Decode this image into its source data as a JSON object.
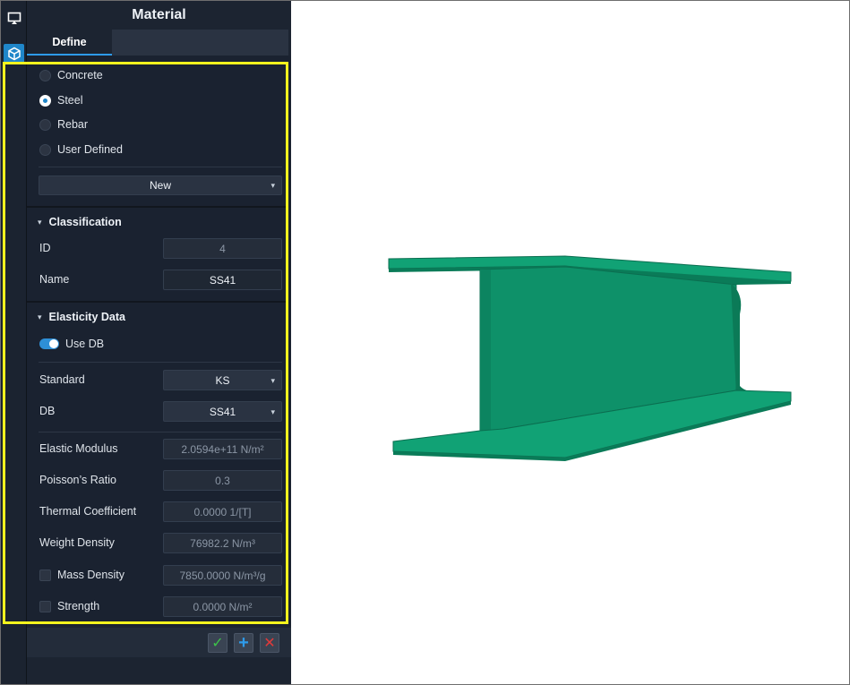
{
  "panel": {
    "title": "Material",
    "tabs": [
      {
        "label": "Define",
        "active": true
      }
    ]
  },
  "rail": {
    "icons": [
      "display-icon",
      "cube-icon"
    ]
  },
  "material_type": {
    "options": [
      {
        "label": "Concrete",
        "selected": false
      },
      {
        "label": "Steel",
        "selected": true
      },
      {
        "label": "Rebar",
        "selected": false
      },
      {
        "label": "User Defined",
        "selected": false
      }
    ],
    "preset_value": "New"
  },
  "classification": {
    "header": "Classification",
    "id_label": "ID",
    "id_value": "4",
    "name_label": "Name",
    "name_value": "SS41"
  },
  "elasticity": {
    "header": "Elasticity Data",
    "use_db_label": "Use DB",
    "use_db_on": true,
    "standard_label": "Standard",
    "standard_value": "KS",
    "db_label": "DB",
    "db_value": "SS41",
    "elastic_modulus_label": "Elastic Modulus",
    "elastic_modulus_value": "2.0594e+11 N/m²",
    "poisson_label": "Poisson’s Ratio",
    "poisson_value": "0.3",
    "thermal_label": "Thermal Coefficient",
    "thermal_value": "0.0000 1/[T]",
    "weight_density_label": "Weight Density",
    "weight_density_value": "76982.2 N/m³",
    "mass_density_label": "Mass Density",
    "mass_density_value": "7850.0000 N/m³/g",
    "mass_density_checked": false,
    "strength_label": "Strength",
    "strength_value": "0.0000 N/m²",
    "strength_checked": false
  },
  "footer": {
    "confirm_glyph": "✓",
    "add_glyph": "+",
    "cancel_glyph": "✕"
  },
  "colors": {
    "accent": "#1f86c9",
    "highlight": "#f5f51e",
    "beam": "#0f9a6e",
    "confirm": "#3cc24a",
    "add": "#2e9bea",
    "cancel": "#e03a3a"
  }
}
